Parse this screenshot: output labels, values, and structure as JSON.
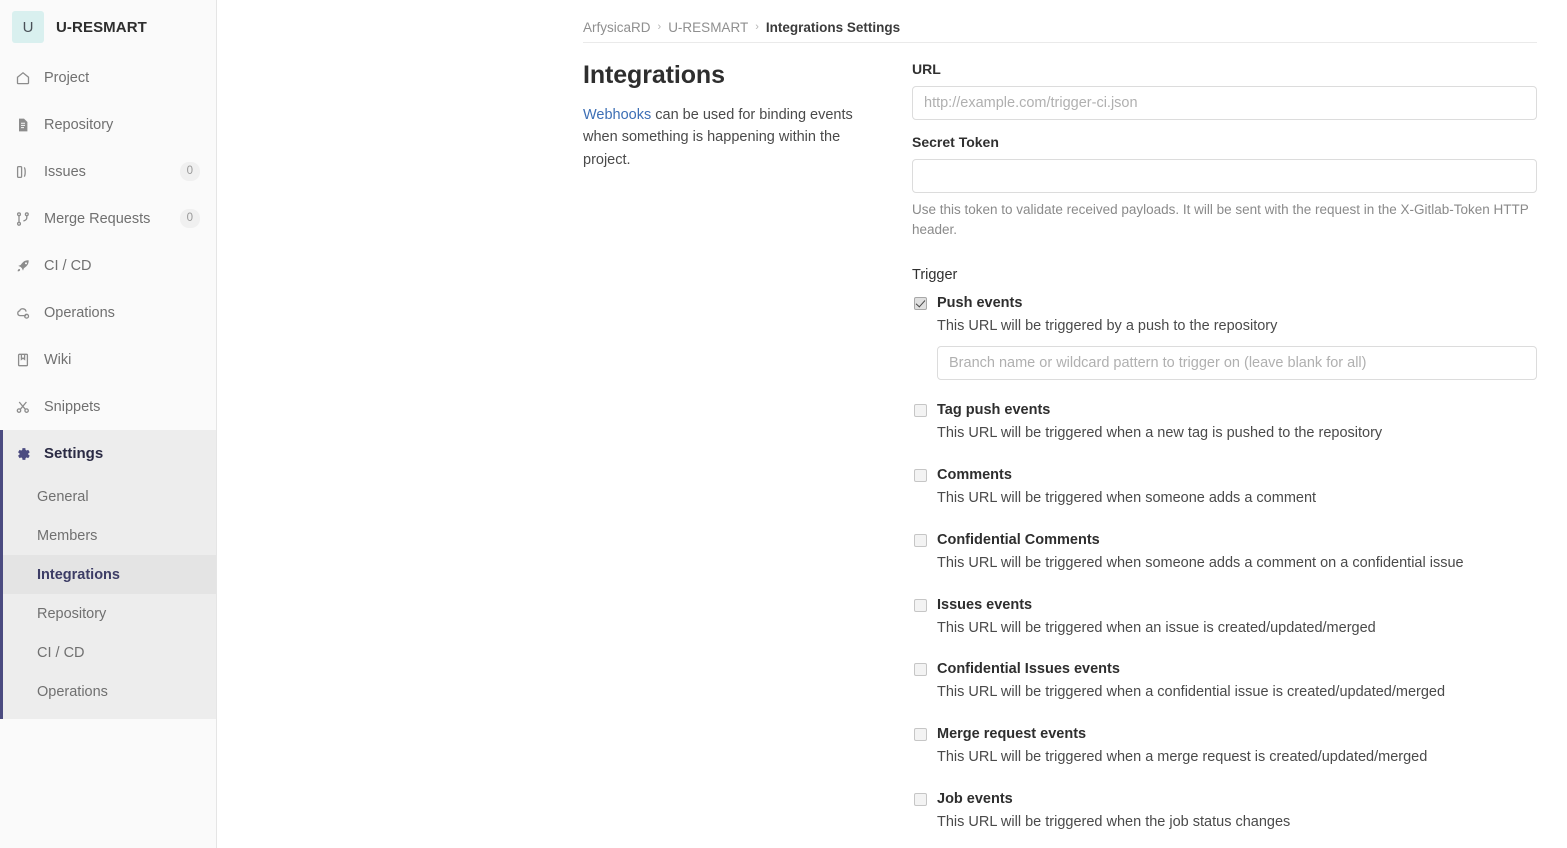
{
  "sidebar": {
    "project": {
      "avatar_initial": "U",
      "name": "U-RESMART"
    },
    "items": [
      {
        "label": "Project",
        "icon": "home-icon",
        "badge": null
      },
      {
        "label": "Repository",
        "icon": "file-icon",
        "badge": null
      },
      {
        "label": "Issues",
        "icon": "issues-icon",
        "badge": "0"
      },
      {
        "label": "Merge Requests",
        "icon": "merge-icon",
        "badge": "0"
      },
      {
        "label": "CI / CD",
        "icon": "rocket-icon",
        "badge": null
      },
      {
        "label": "Operations",
        "icon": "cloud-gear-icon",
        "badge": null
      },
      {
        "label": "Wiki",
        "icon": "book-icon",
        "badge": null
      },
      {
        "label": "Snippets",
        "icon": "scissors-icon",
        "badge": null
      }
    ],
    "settings": {
      "label": "Settings",
      "icon": "gear-icon",
      "sub_items": [
        {
          "label": "General",
          "active": false
        },
        {
          "label": "Members",
          "active": false
        },
        {
          "label": "Integrations",
          "active": true
        },
        {
          "label": "Repository",
          "active": false
        },
        {
          "label": "CI / CD",
          "active": false
        },
        {
          "label": "Operations",
          "active": false
        }
      ]
    },
    "accent_color": "#4b4b80"
  },
  "breadcrumb": {
    "items": [
      "ArfysicaRD",
      "U-RESMART"
    ],
    "current": "Integrations Settings",
    "separator": "›"
  },
  "page": {
    "title": "Integrations",
    "description_link": "Webhooks",
    "description_rest": " can be used for binding events when something is happening within the project."
  },
  "form": {
    "url": {
      "label": "URL",
      "value": "",
      "placeholder": "http://example.com/trigger-ci.json"
    },
    "secret_token": {
      "label": "Secret Token",
      "value": "",
      "placeholder": "",
      "help": "Use this token to validate received payloads. It will be sent with the request in the X-Gitlab-Token HTTP header."
    },
    "trigger_label": "Trigger",
    "triggers": [
      {
        "name": "Push events",
        "description": "This URL will be triggered by a push to the repository",
        "checked": true,
        "input": {
          "value": "",
          "placeholder": "Branch name or wildcard pattern to trigger on (leave blank for all)"
        }
      },
      {
        "name": "Tag push events",
        "description": "This URL will be triggered when a new tag is pushed to the repository",
        "checked": false,
        "input": null
      },
      {
        "name": "Comments",
        "description": "This URL will be triggered when someone adds a comment",
        "checked": false,
        "input": null
      },
      {
        "name": "Confidential Comments",
        "description": "This URL will be triggered when someone adds a comment on a confidential issue",
        "checked": false,
        "input": null
      },
      {
        "name": "Issues events",
        "description": "This URL will be triggered when an issue is created/updated/merged",
        "checked": false,
        "input": null
      },
      {
        "name": "Confidential Issues events",
        "description": "This URL will be triggered when a confidential issue is created/updated/merged",
        "checked": false,
        "input": null
      },
      {
        "name": "Merge request events",
        "description": "This URL will be triggered when a merge request is created/updated/merged",
        "checked": false,
        "input": null
      },
      {
        "name": "Job events",
        "description": "This URL will be triggered when the job status changes",
        "checked": false,
        "input": null
      }
    ]
  },
  "colors": {
    "link": "#3d6fb5",
    "sidebar_bg": "#fafafa",
    "active_bg": "#e4e4e4"
  }
}
